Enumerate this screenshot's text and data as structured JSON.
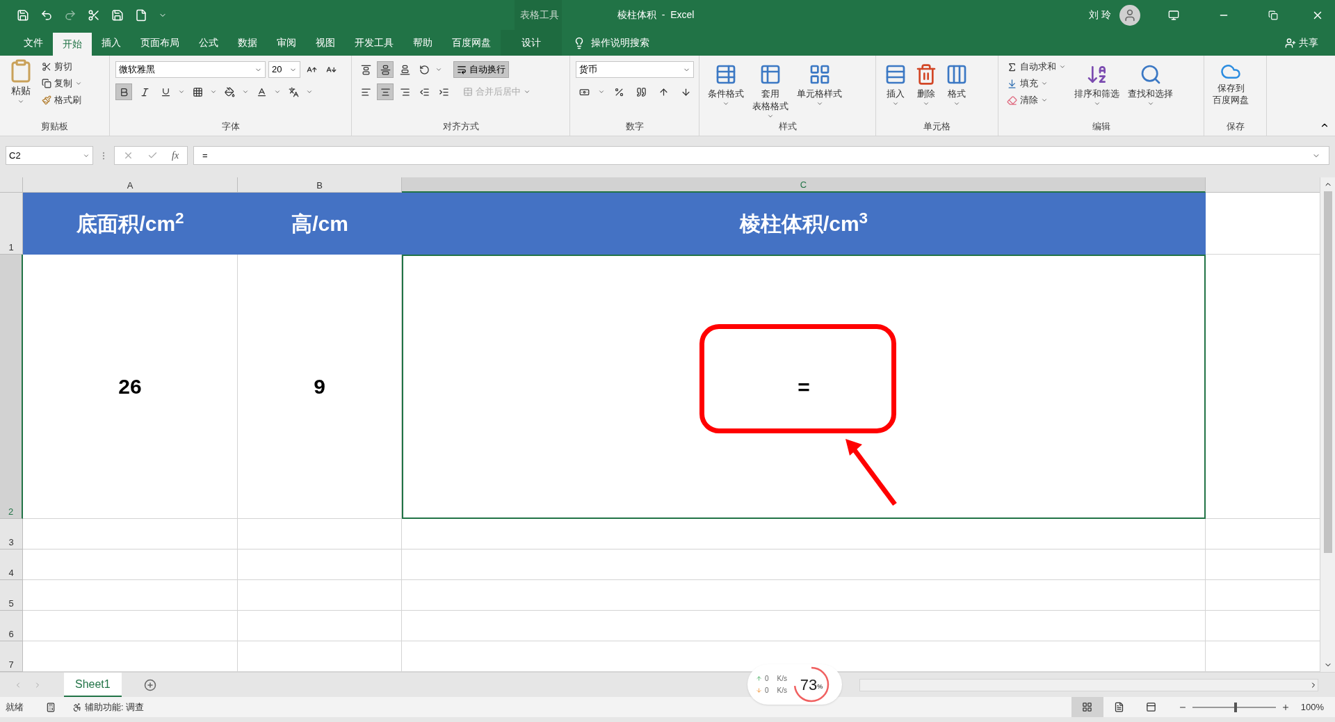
{
  "window": {
    "context_label": "表格工具",
    "title": "棱柱体积  -  Excel",
    "user": "刘 玲"
  },
  "menu_tabs": [
    {
      "label": "文件",
      "selected": false,
      "kind": "normal"
    },
    {
      "label": "开始",
      "selected": true,
      "kind": "normal"
    },
    {
      "label": "插入",
      "selected": false,
      "kind": "normal"
    },
    {
      "label": "页面布局",
      "selected": false,
      "kind": "normal"
    },
    {
      "label": "公式",
      "selected": false,
      "kind": "normal"
    },
    {
      "label": "数据",
      "selected": false,
      "kind": "normal"
    },
    {
      "label": "审阅",
      "selected": false,
      "kind": "normal"
    },
    {
      "label": "视图",
      "selected": false,
      "kind": "normal"
    },
    {
      "label": "开发工具",
      "selected": false,
      "kind": "normal"
    },
    {
      "label": "帮助",
      "selected": false,
      "kind": "normal"
    },
    {
      "label": "百度网盘",
      "selected": false,
      "kind": "normal"
    },
    {
      "label": "设计",
      "selected": false,
      "kind": "contextual"
    }
  ],
  "tell_me": "操作说明搜索",
  "share": "共享",
  "ribbon": {
    "clipboard": {
      "name": "剪贴板",
      "paste": "粘贴",
      "cut": "剪切",
      "copy": "复制",
      "format_painter": "格式刷"
    },
    "font": {
      "name": "字体",
      "font_family": "微软雅黑",
      "font_size": "20",
      "bold": true,
      "italic": false,
      "underline": false
    },
    "alignment": {
      "name": "对齐方式",
      "wrap_text": "自动换行",
      "wrap_on": true,
      "merge": "合并后居中",
      "merge_disabled": true,
      "middle_align": true,
      "center_align": true
    },
    "number": {
      "name": "数字",
      "format": "货币"
    },
    "styles": {
      "name": "样式",
      "buttons": [
        {
          "lines": [
            "条件格式"
          ]
        },
        {
          "lines": [
            "套用",
            "表格格式"
          ]
        },
        {
          "lines": [
            "单元格样式"
          ]
        }
      ]
    },
    "cells": {
      "name": "单元格",
      "buttons": [
        "插入",
        "删除",
        "格式"
      ]
    },
    "editing": {
      "name": "编辑",
      "autosum": "自动求和",
      "fill": "填充",
      "clear": "清除",
      "sort": "排序和筛选",
      "find": "查找和选择"
    },
    "save": {
      "name": "保存",
      "lines": [
        "保存到",
        "百度网盘"
      ]
    }
  },
  "formula_bar": {
    "name_box": "C2",
    "fx": "fx",
    "formula": "="
  },
  "sheet": {
    "columns": [
      {
        "label": "A",
        "selected": false
      },
      {
        "label": "B",
        "selected": false
      },
      {
        "label": "C",
        "selected": true
      }
    ],
    "rows": [
      {
        "header": "1",
        "selected": false,
        "kind": "header",
        "cells": [
          {
            "text": "底面积/cm$^{2}$",
            "selected": false
          },
          {
            "text": "高/cm",
            "selected": false
          },
          {
            "text": "棱柱体积/cm$^{3}$",
            "selected": false
          }
        ]
      },
      {
        "header": "2",
        "selected": true,
        "kind": "data",
        "cells": [
          {
            "text": "26",
            "selected": false
          },
          {
            "text": "9",
            "selected": false
          },
          {
            "text": "=",
            "selected": true
          }
        ]
      },
      {
        "header": "3",
        "selected": false,
        "kind": "empty"
      },
      {
        "header": "4",
        "selected": false,
        "kind": "empty"
      },
      {
        "header": "5",
        "selected": false,
        "kind": "empty"
      },
      {
        "header": "6",
        "selected": false,
        "kind": "empty"
      },
      {
        "header": "7",
        "selected": false,
        "kind": "empty"
      }
    ]
  },
  "sheet_tabs": [
    {
      "label": "Sheet1",
      "selected": true
    }
  ],
  "speed_widget": {
    "upload": "0",
    "download": "0",
    "upload_unit": "K/s",
    "download_unit": "K/s",
    "percent": "73",
    "percent_sign": "%",
    "level": 0.73
  },
  "status_bar": {
    "mode": "就绪",
    "accessibility": "辅助功能: 调查",
    "views": [
      {
        "selected": true
      },
      {
        "selected": false
      },
      {
        "selected": false
      }
    ],
    "zoom": "100%",
    "zoom_slider": {
      "level": 0.5
    }
  }
}
